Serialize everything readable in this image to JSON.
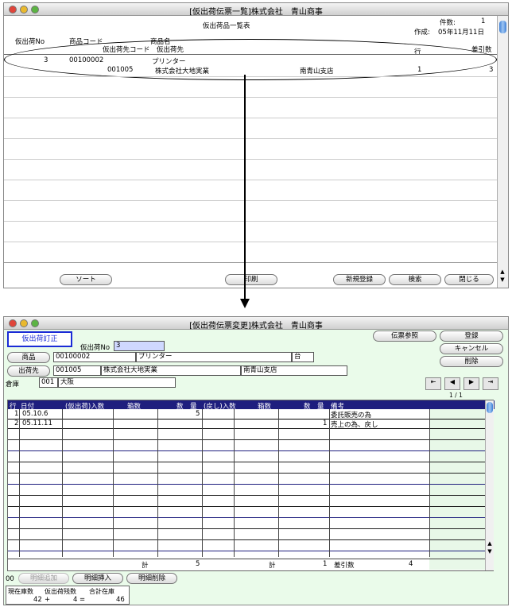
{
  "list_window": {
    "title": "[仮出荷伝票一覧]株式会社　青山商事",
    "subtitle": "仮出荷品一覧表",
    "count_label": "件数:",
    "count_value": "1",
    "created_label": "作成:",
    "created_value": "05年11月11日",
    "headers": {
      "no": "仮出荷No",
      "product_code": "商品コード",
      "product_name": "商品名",
      "dest_code": "仮出荷先コード",
      "dest_name": "仮出荷先",
      "line": "行",
      "diff": "差引数"
    },
    "record": {
      "no": "3",
      "product_code": "00100002",
      "product_name": "プリンター",
      "dest_code": "001005",
      "dest_name": "株式会社大地実業",
      "branch": "南青山支店",
      "line": "1",
      "diff": "3"
    },
    "buttons": {
      "sort": "ソート",
      "print": "印刷",
      "new": "新規登録",
      "search": "検索",
      "close": "閉じる"
    }
  },
  "edit_window": {
    "title": "[仮出荷伝票変更]株式会社　青山商事",
    "mode_label": "仮出荷訂正",
    "no_label": "仮出荷No",
    "no_value": "3",
    "product_button": "商品",
    "product_code": "00100002",
    "product_name": "プリンター",
    "unit": "台",
    "dest_button": "出荷先",
    "dest_code": "001005",
    "dest_name": "株式会社大地実業",
    "dest_branch": "南青山支店",
    "warehouse_label": "倉庫",
    "warehouse_code": "001",
    "warehouse_name": "大阪",
    "page_indicator": "1 / 1",
    "buttons": {
      "ref": "伝票参照",
      "register": "登録",
      "cancel": "キャンセル",
      "delete": "削除",
      "add_line": "明細追加",
      "insert_line": "明細挿入",
      "delete_line": "明細削除"
    },
    "table_headers": [
      "行",
      "日付",
      "(仮出荷)入数",
      "箱数",
      "数　量",
      "(戻し)入数",
      "箱数",
      "数　量",
      "備考"
    ],
    "rows": [
      {
        "line": "1",
        "date": "05.10.6",
        "in_qty": "",
        "boxes": "",
        "qty": "5",
        "ret_in": "",
        "ret_boxes": "",
        "ret_qty": "",
        "note": "委託販売の為"
      },
      {
        "line": "2",
        "date": "05.11.11",
        "in_qty": "",
        "boxes": "",
        "qty": "",
        "ret_in": "",
        "ret_boxes": "",
        "ret_qty": "1",
        "note": "売上の為、戻し"
      }
    ],
    "totals": {
      "label1": "計",
      "value1": "5",
      "label2": "計",
      "value2": "1",
      "diff_label": "差引数",
      "diff_value": "4"
    },
    "line_count": "00",
    "stock": {
      "headers": [
        "現在庫数",
        "仮出荷残数",
        "合計在庫"
      ],
      "current": "42",
      "op1": "+",
      "pending": "4",
      "op2": "=",
      "total": "46"
    }
  }
}
